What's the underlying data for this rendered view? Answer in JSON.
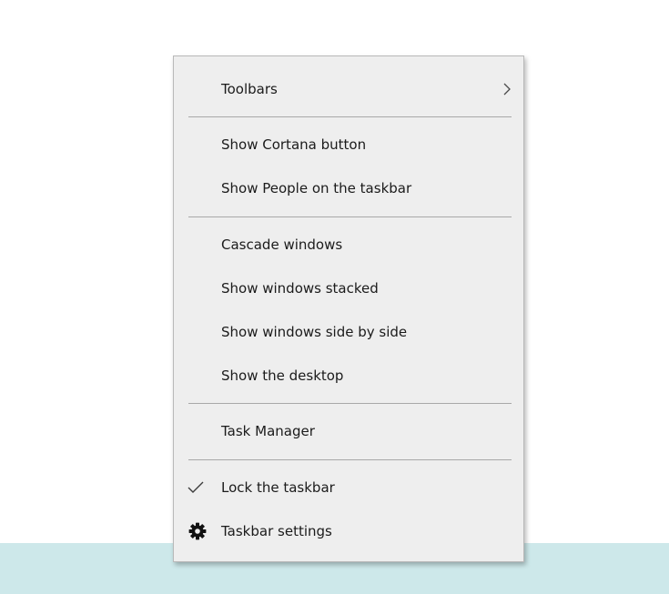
{
  "menu": {
    "toolbars": {
      "label": "Toolbars",
      "icon": "chevron-right-icon"
    },
    "show_cortana_button": {
      "label": "Show Cortana button"
    },
    "show_people": {
      "label": "Show People on the taskbar"
    },
    "cascade_windows": {
      "label": "Cascade windows"
    },
    "show_windows_stacked": {
      "label": "Show windows stacked"
    },
    "show_windows_side_by_side": {
      "label": "Show windows side by side"
    },
    "show_desktop": {
      "label": "Show the desktop"
    },
    "task_manager": {
      "label": "Task Manager"
    },
    "lock_taskbar": {
      "label": "Lock the taskbar",
      "checked": true,
      "icon": "checkmark-icon"
    },
    "taskbar_settings": {
      "label": "Taskbar settings",
      "icon": "gear-icon"
    }
  },
  "colors": {
    "menu_background": "#eeeeee",
    "menu_border": "#b9b9b9",
    "separator": "#a8a8a8",
    "text": "#1b1b1b",
    "taskbar_strip": "#cde8ea"
  }
}
